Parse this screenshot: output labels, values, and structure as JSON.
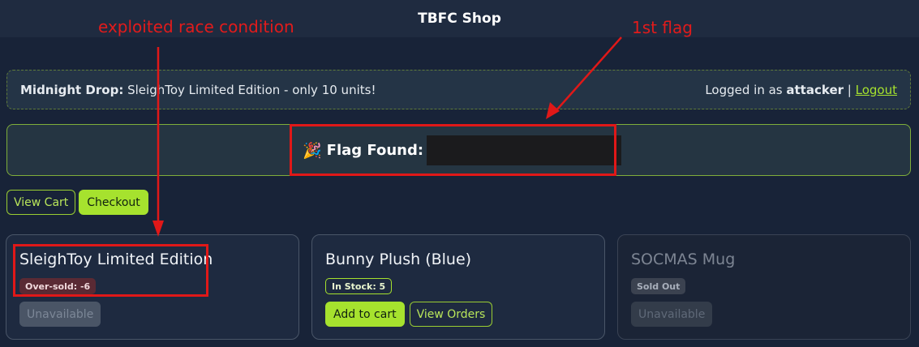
{
  "header": {
    "title": "TBFC Shop"
  },
  "announcement": {
    "label": "Midnight Drop:",
    "text": "SleighToy Limited Edition - only 10 units!",
    "logged_in_prefix": "Logged in as",
    "username": "attacker",
    "separator": "|",
    "logout_label": "Logout"
  },
  "flag_banner": {
    "icon": "party-popper-icon",
    "emoji": "🎉",
    "label": "Flag Found:"
  },
  "toolbar": {
    "view_cart_label": "View Cart",
    "checkout_label": "Checkout"
  },
  "products": [
    {
      "name": "SleighToy Limited Edition",
      "badge": "Over-sold: -6",
      "action_label": "Unavailable"
    },
    {
      "name": "Bunny Plush (Blue)",
      "badge": "In Stock: 5",
      "add_label": "Add to cart",
      "orders_label": "View Orders"
    },
    {
      "name": "SOCMAS Mug",
      "badge": "Sold Out",
      "action_label": "Unavailable"
    }
  ],
  "annotations": {
    "race_condition": "exploited race condition",
    "first_flag": "1st flag",
    "color": "#e21b1b"
  },
  "colors": {
    "accent": "#a6e22e",
    "background": "#182338",
    "oversold_badge": "#5a2a34"
  }
}
